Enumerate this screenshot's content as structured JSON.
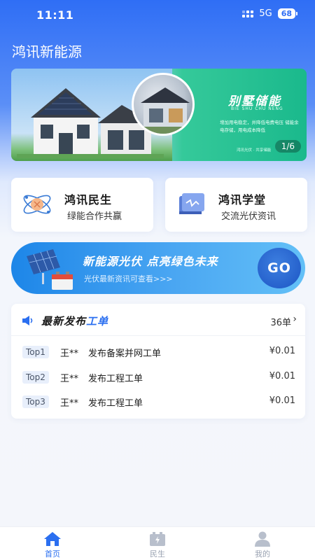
{
  "status": {
    "time": "11:11",
    "network": "5G",
    "battery": "68"
  },
  "app": {
    "title": "鸿讯新能源"
  },
  "banner": {
    "headline": "别墅储能",
    "pinyin": "BIE SHU CHU NENG",
    "description": "增加用电稳定，并降低电费电压 储能余电存储，用电成本降低",
    "footer": "鸿讯光伏 · 共享储能",
    "pager": "1/6"
  },
  "features": [
    {
      "title": "鸿讯民生",
      "subtitle": "绿能合作共赢",
      "icon": "atom-icon"
    },
    {
      "title": "鸿讯学堂",
      "subtitle": "交流光伏资讯",
      "icon": "book-icon"
    }
  ],
  "promo": {
    "title": "新能源光伏  点亮绿色未来",
    "subtitle": "光伏最新资讯可查看>>>",
    "button": "GO"
  },
  "orders": {
    "title_main": "最新发布",
    "title_accent": "工单",
    "count": "36单",
    "rows": [
      {
        "rank": "Top1",
        "name": "王**",
        "desc": "发布备案并网工单",
        "price": "¥0.01"
      },
      {
        "rank": "Top2",
        "name": "王**",
        "desc": "发布工程工单",
        "price": "¥0.01"
      },
      {
        "rank": "Top3",
        "name": "王**",
        "desc": "发布工程工单",
        "price": "¥0.01"
      }
    ]
  },
  "tabs": [
    {
      "label": "首页",
      "icon": "home-icon",
      "active": true
    },
    {
      "label": "民生",
      "icon": "battery-box-icon",
      "active": false
    },
    {
      "label": "我的",
      "icon": "user-icon",
      "active": false
    }
  ],
  "colors": {
    "primary": "#2b6ff0",
    "banner_green": "#1ab98c",
    "text": "#222222"
  }
}
